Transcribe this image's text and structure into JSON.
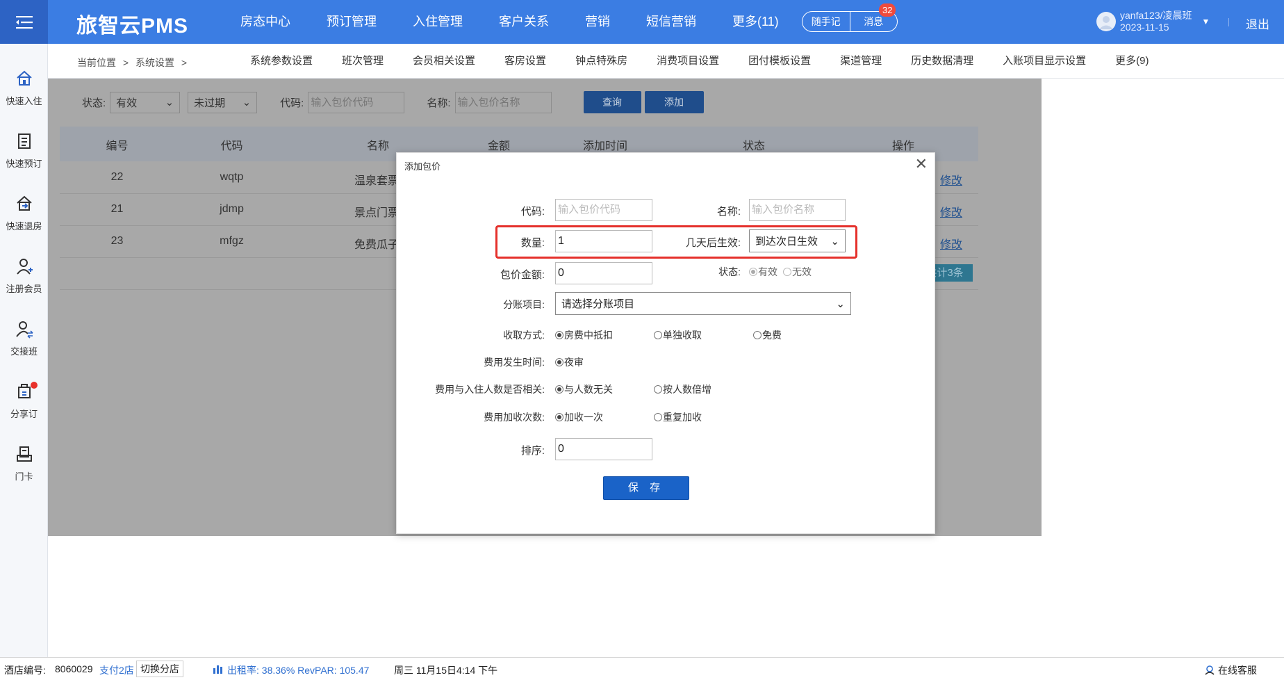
{
  "app": {
    "logo": "旅智云PMS"
  },
  "nav": [
    "房态中心",
    "预订管理",
    "入住管理",
    "客户关系",
    "营销",
    "短信营销",
    "更多(11)"
  ],
  "quick": {
    "note": "随手记",
    "message": "消息",
    "badge": "32"
  },
  "user": {
    "name": "yanfa123/凌晨班",
    "date": "2023-11-15",
    "logout": "退出"
  },
  "sidebar": [
    {
      "label": "快速入住",
      "icon": "home-icon"
    },
    {
      "label": "快速预订",
      "icon": "booking-icon"
    },
    {
      "label": "快速退房",
      "icon": "checkout-icon"
    },
    {
      "label": "注册会员",
      "icon": "add-member-icon"
    },
    {
      "label": "交接班",
      "icon": "shift-icon"
    },
    {
      "label": "分享订",
      "icon": "share-icon"
    },
    {
      "label": "门卡",
      "icon": "card-icon"
    }
  ],
  "breadcrumb": {
    "current": "当前位置",
    "sep": ">",
    "page": "系统设置"
  },
  "subnav": [
    "系统参数设置",
    "班次管理",
    "会员相关设置",
    "客房设置",
    "钟点特殊房",
    "消费项目设置",
    "团付模板设置",
    "渠道管理",
    "历史数据清理",
    "入账项目显示设置",
    "更多(9)"
  ],
  "filter": {
    "status_label": "状态:",
    "status_value": "有效",
    "expire_value": "未过期",
    "code_label": "代码:",
    "code_placeholder": "输入包价代码",
    "name_label": "名称:",
    "name_placeholder": "输入包价名称",
    "query": "查询",
    "add": "添加"
  },
  "table": {
    "headers": [
      "编号",
      "代码",
      "名称",
      "金额",
      "添加时间",
      "状态",
      "操作"
    ],
    "rows": [
      {
        "id": "22",
        "code": "wqtp",
        "name": "温泉套票",
        "action": "修改"
      },
      {
        "id": "21",
        "code": "jdmp",
        "name": "景点门票",
        "action": "修改"
      },
      {
        "id": "23",
        "code": "mfgz",
        "name": "免费瓜子",
        "action": "修改"
      }
    ],
    "total": "共计3条"
  },
  "modal": {
    "title": "添加包价",
    "code_label": "代码:",
    "code_placeholder": "输入包价代码",
    "name_label": "名称:",
    "name_placeholder": "输入包价名称",
    "qty_label": "数量:",
    "qty_value": "1",
    "days_label": "几天后生效:",
    "days_value": "到达次日生效",
    "amount_label": "包价金额:",
    "amount_value": "0",
    "status_label": "状态:",
    "status_on": "有效",
    "status_off": "无效",
    "split_label": "分账项目:",
    "split_value": "请选择分账项目",
    "charge_label": "收取方式:",
    "charge_options": [
      "房费中抵扣",
      "单独收取",
      "免费"
    ],
    "time_label": "费用发生时间:",
    "time_options": [
      "夜审"
    ],
    "people_label": "费用与入住人数是否相关:",
    "people_options": [
      "与人数无关",
      "按人数倍增"
    ],
    "times_label": "费用加收次数:",
    "times_options": [
      "加收一次",
      "重复加收"
    ],
    "sort_label": "排序:",
    "sort_value": "0",
    "save": "保 存"
  },
  "statusbar": {
    "hotel_label": "酒店编号:",
    "hotel_id": "8060029",
    "store_link": "支付2店",
    "switch": "切换分店",
    "occupancy": "出租率: 38.36% RevPAR: 105.47",
    "datetime": "周三 11月15日4:14 下午",
    "service": "在线客服"
  },
  "colors": {
    "topbar": "#3b7de3",
    "highlight": "#e5302b",
    "primary_button": "#1a63c8"
  }
}
